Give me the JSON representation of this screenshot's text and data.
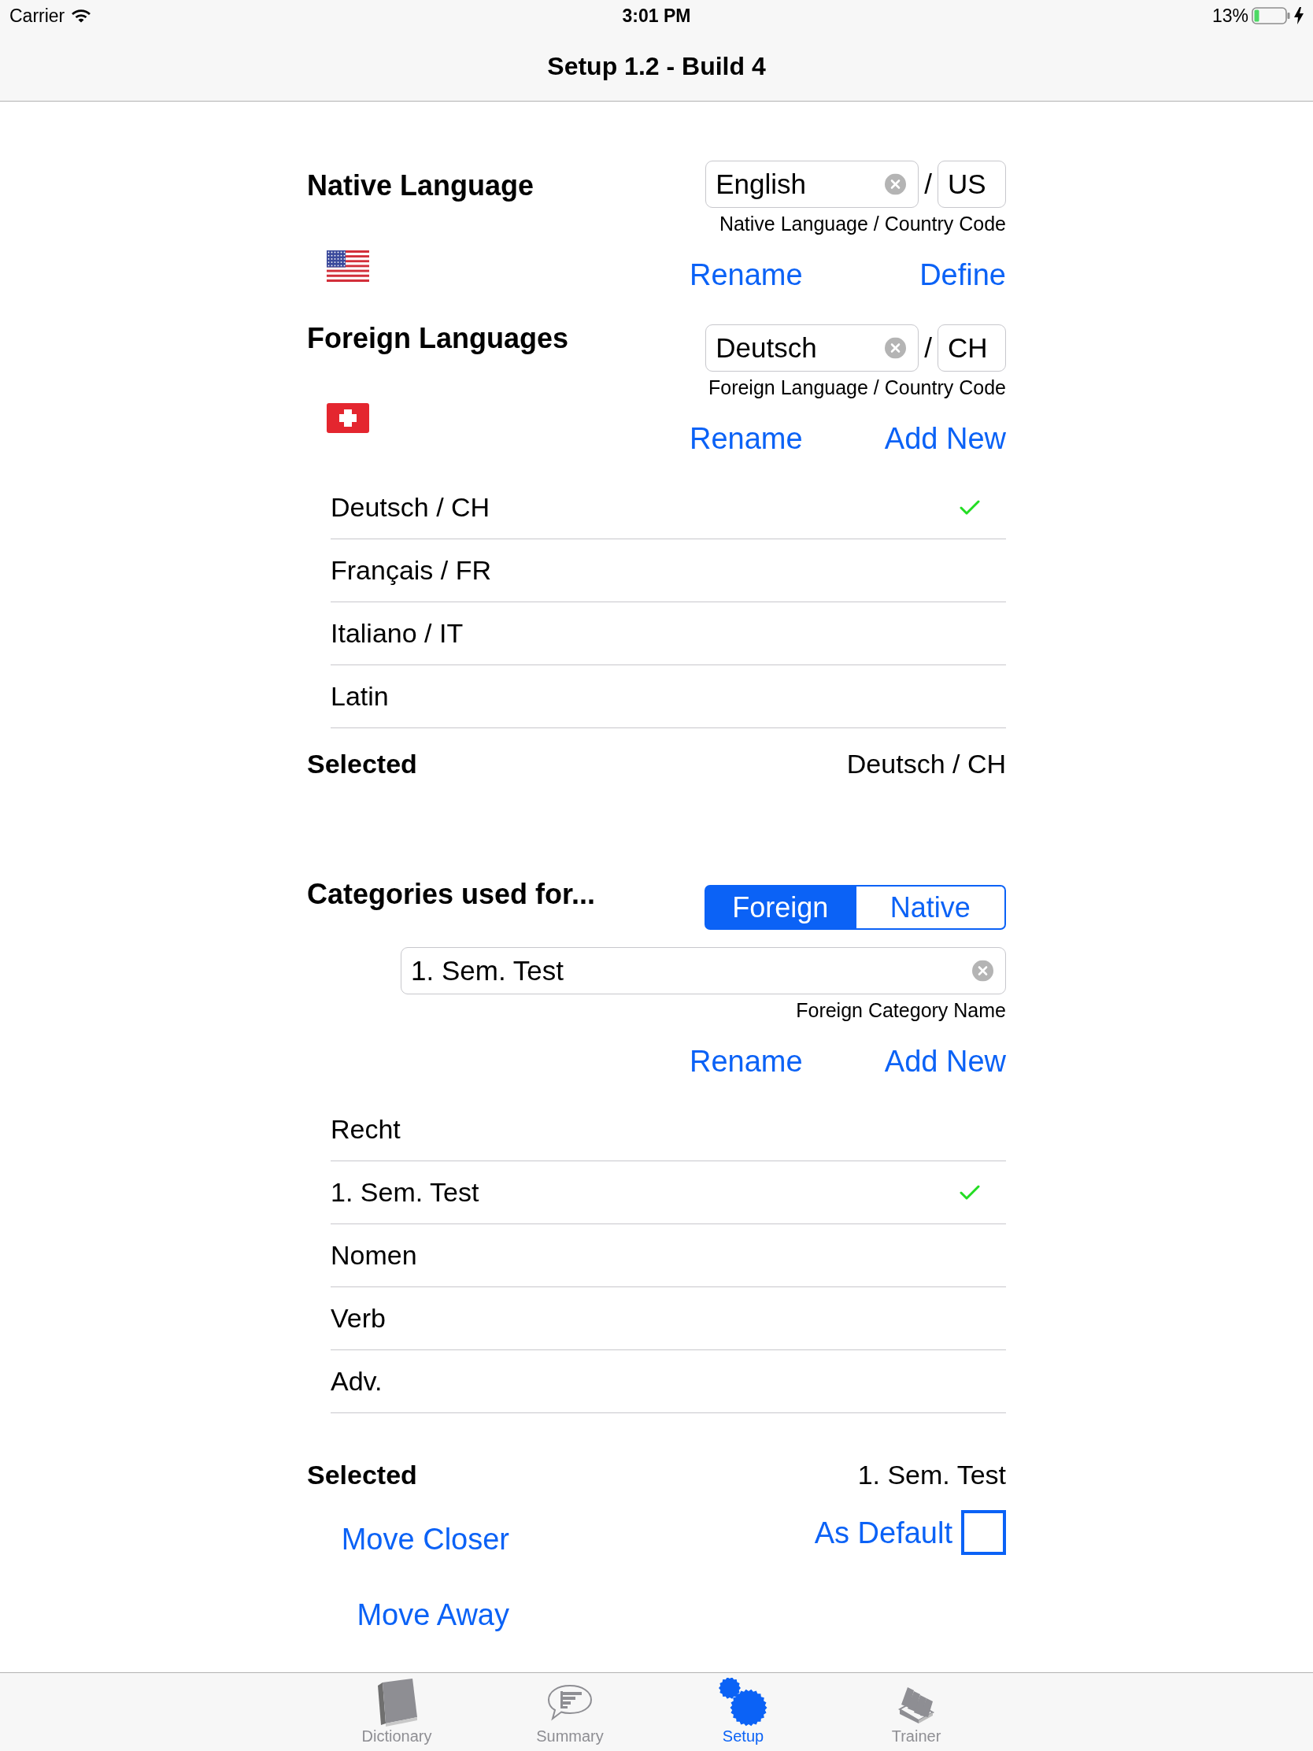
{
  "status_bar": {
    "carrier": "Carrier",
    "time": "3:01 PM",
    "battery": "13%"
  },
  "nav_bar": {
    "title": "Setup 1.2 - Build 4"
  },
  "native_language": {
    "heading": "Native Language",
    "language_field": {
      "value": "English"
    },
    "separator": "/",
    "country_field": {
      "value": "US"
    },
    "caption": "Native Language / Country Code",
    "buttons": [
      "Rename",
      "Define"
    ]
  },
  "foreign_languages": {
    "heading": "Foreign Languages",
    "language_field": {
      "value": "Deutsch"
    },
    "separator": "/",
    "country_field": {
      "value": "CH"
    },
    "caption": "Foreign Language / Country Code",
    "buttons": [
      "Rename",
      "Add New"
    ],
    "list": [
      {
        "label": "Deutsch / CH",
        "selected": true
      },
      {
        "label": "Français / FR",
        "selected": false
      },
      {
        "label": "Italiano / IT",
        "selected": false
      },
      {
        "label": "Latin",
        "selected": false
      }
    ],
    "selected_label": "Selected",
    "selected_value": "Deutsch / CH"
  },
  "categories": {
    "heading": "Categories used for...",
    "segments": [
      {
        "label": "Foreign",
        "selected": true
      },
      {
        "label": "Native",
        "selected": false
      }
    ],
    "name_field": {
      "value": "1. Sem. Test"
    },
    "caption": "Foreign Category Name",
    "buttons": [
      "Rename",
      "Add New"
    ],
    "list": [
      {
        "label": "Recht",
        "selected": false
      },
      {
        "label": "1. Sem. Test",
        "selected": true
      },
      {
        "label": "Nomen",
        "selected": false
      },
      {
        "label": "Verb",
        "selected": false
      },
      {
        "label": "Adv.",
        "selected": false
      }
    ],
    "selected_label": "Selected",
    "selected_value": "1. Sem. Test",
    "move_buttons": [
      "Move Closer",
      "Move Away"
    ],
    "default_toggle": {
      "label": "As Default",
      "checked": false
    }
  },
  "tab_bar": {
    "tabs": [
      {
        "label": "Dictionary",
        "selected": false
      },
      {
        "label": "Summary",
        "selected": false
      },
      {
        "label": "Setup",
        "selected": true
      },
      {
        "label": "Trainer",
        "selected": false
      }
    ]
  }
}
